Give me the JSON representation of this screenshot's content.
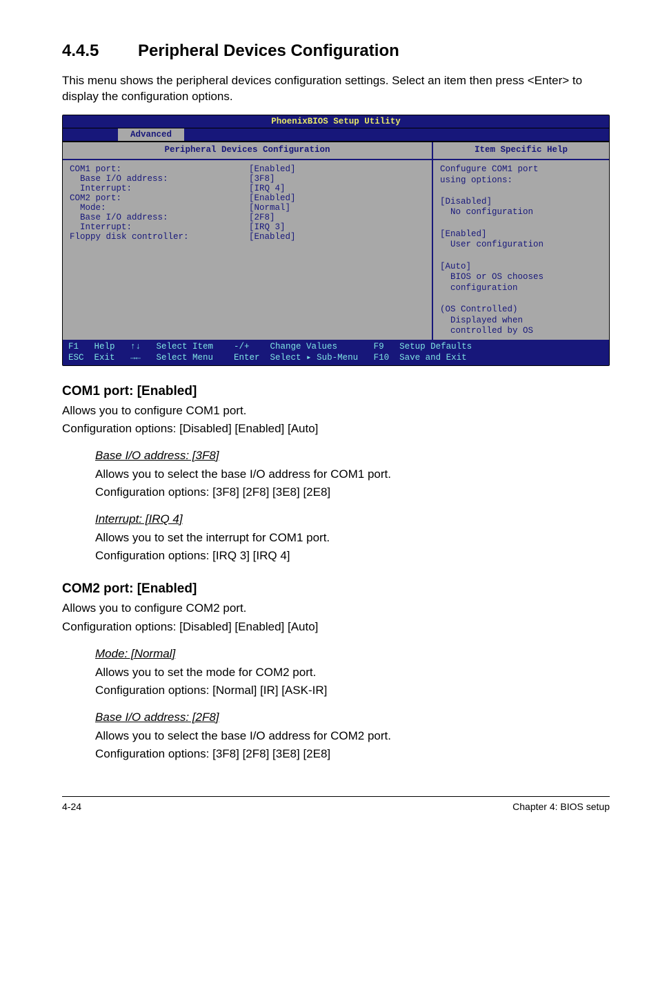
{
  "heading": {
    "number": "4.4.5",
    "title": "Peripheral Devices Configuration"
  },
  "intro": "This menu shows the peripheral devices configuration settings. Select an item then press <Enter> to display the configuration options.",
  "bios": {
    "title": "PhoenixBIOS Setup Utility",
    "tab": "Advanced",
    "left_header": "Peripheral Devices Configuration",
    "right_header": "Item Specific Help",
    "rows": [
      {
        "label": "COM1 port:",
        "indent": 0,
        "value": "[Enabled]"
      },
      {
        "label": "Base I/O address:",
        "indent": 1,
        "value": "[3F8]"
      },
      {
        "label": "Interrupt:",
        "indent": 1,
        "value": "[IRQ 4]"
      },
      {
        "label": "COM2 port:",
        "indent": 0,
        "value": "[Enabled]"
      },
      {
        "label": "Mode:",
        "indent": 1,
        "value": "[Normal]"
      },
      {
        "label": "Base I/O address:",
        "indent": 1,
        "value": "[2F8]"
      },
      {
        "label": "Interrupt:",
        "indent": 1,
        "value": "[IRQ 3]"
      },
      {
        "label": "Floppy disk controller:",
        "indent": 0,
        "value": "[Enabled]"
      }
    ],
    "help": "Confugure COM1 port\nusing options:\n\n[Disabled]\n  No configuration\n\n[Enabled]\n  User configuration\n\n[Auto]\n  BIOS or OS chooses\n  configuration\n\n(OS Controlled)\n  Displayed when\n  controlled by OS",
    "footer1": "F1   Help   ↑↓   Select Item    -/+    Change Values       F9   Setup Defaults",
    "footer2": "ESC  Exit   →←   Select Menu    Enter  Select ▸ Sub-Menu   F10  Save and Exit"
  },
  "com1": {
    "title": "COM1 port: [Enabled]",
    "line1": "Allows you to configure COM1 port.",
    "line2": "Configuration options: [Disabled] [Enabled] [Auto]",
    "base": {
      "title": "Base I/O address: [3F8]",
      "l1": "Allows you to select the base I/O address for COM1 port.",
      "l2": "Configuration options: [3F8] [2F8] [3E8] [2E8]"
    },
    "irq": {
      "title": "Interrupt: [IRQ 4]",
      "l1": "Allows you to set the interrupt for COM1 port.",
      "l2": "Configuration options: [IRQ 3] [IRQ 4]"
    }
  },
  "com2": {
    "title": "COM2 port: [Enabled]",
    "line1": "Allows you to configure COM2 port.",
    "line2": "Configuration options: [Disabled] [Enabled] [Auto]",
    "mode": {
      "title": "Mode: [Normal]",
      "l1": "Allows you to set the mode for COM2 port.",
      "l2": "Configuration options: [Normal] [IR] [ASK-IR]"
    },
    "base": {
      "title": "Base I/O address: [2F8]",
      "l1": "Allows you to select the base I/O address for COM2 port.",
      "l2": "Configuration options: [3F8] [2F8] [3E8] [2E8]"
    }
  },
  "footer": {
    "left": "4-24",
    "right": "Chapter 4: BIOS setup"
  }
}
